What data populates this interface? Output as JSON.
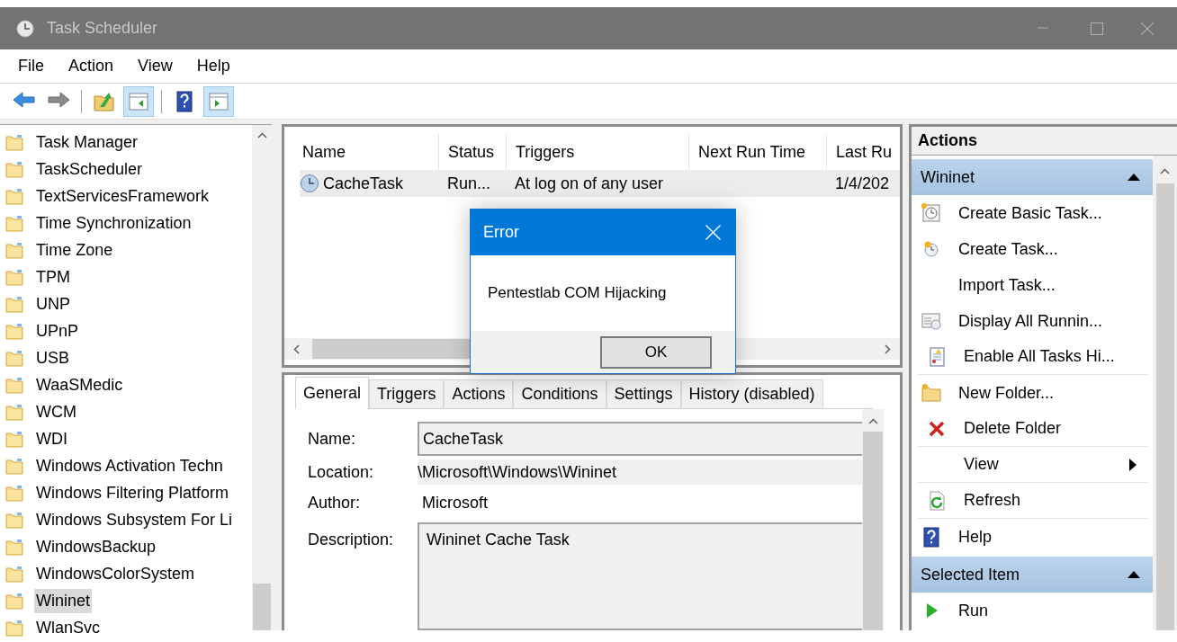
{
  "window": {
    "title": "Task Scheduler"
  },
  "menu": [
    "File",
    "Action",
    "View",
    "Help"
  ],
  "toolbar": [
    {
      "kind": "back",
      "selected": false
    },
    {
      "kind": "forward",
      "selected": false
    },
    {
      "kind": "up",
      "selected": false
    },
    {
      "kind": "console-tree",
      "selected": true
    },
    {
      "kind": "help",
      "selected": false
    },
    {
      "kind": "action-pane",
      "selected": true
    }
  ],
  "tree": {
    "items": [
      {
        "label": "Task Manager",
        "selected": false
      },
      {
        "label": "TaskScheduler",
        "selected": false
      },
      {
        "label": "TextServicesFramework",
        "selected": false
      },
      {
        "label": "Time Synchronization",
        "selected": false
      },
      {
        "label": "Time Zone",
        "selected": false
      },
      {
        "label": "TPM",
        "selected": false
      },
      {
        "label": "UNP",
        "selected": false
      },
      {
        "label": "UPnP",
        "selected": false
      },
      {
        "label": "USB",
        "selected": false
      },
      {
        "label": "WaaSMedic",
        "selected": false
      },
      {
        "label": "WCM",
        "selected": false
      },
      {
        "label": "WDI",
        "selected": false
      },
      {
        "label": "Windows Activation Techn",
        "selected": false
      },
      {
        "label": "Windows Filtering Platform",
        "selected": false
      },
      {
        "label": "Windows Subsystem For Li",
        "selected": false
      },
      {
        "label": "WindowsBackup",
        "selected": false
      },
      {
        "label": "WindowsColorSystem",
        "selected": false
      },
      {
        "label": "Wininet",
        "selected": true
      },
      {
        "label": "WlanSvc",
        "selected": false
      }
    ]
  },
  "task_list": {
    "columns": [
      "Name",
      "Status",
      "Triggers",
      "Next Run Time",
      "Last Ru"
    ],
    "rows": [
      {
        "cells": [
          "CacheTask",
          "Run...",
          "At log on of any user",
          "",
          "1/4/202"
        ],
        "selected": true
      }
    ]
  },
  "detail_tabs": [
    {
      "label": "General",
      "selected": true
    },
    {
      "label": "Triggers",
      "selected": false
    },
    {
      "label": "Actions",
      "selected": false
    },
    {
      "label": "Conditions",
      "selected": false
    },
    {
      "label": "Settings",
      "selected": false
    },
    {
      "label": "History (disabled)",
      "selected": false
    }
  ],
  "general": [
    {
      "label": "Name:",
      "value": "CacheTask",
      "kind": "box"
    },
    {
      "label": "Location:",
      "value": "\\Microsoft\\Windows\\Wininet",
      "kind": "shaded"
    },
    {
      "label": "Author:",
      "value": "Microsoft",
      "kind": "plain"
    },
    {
      "label": "Description:",
      "value": "Wininet Cache Task",
      "kind": "area"
    }
  ],
  "actions": {
    "title": "Actions",
    "sections": [
      {
        "title": "Wininet",
        "expanded": true,
        "items": [
          {
            "label": "Create Basic Task...",
            "kind": "basic-task",
            "divider_after": false
          },
          {
            "label": "Create Task...",
            "kind": "task",
            "divider_after": false
          },
          {
            "label": "Import Task...",
            "kind": "none",
            "divider_after": false
          },
          {
            "label": "Display All Runnin...",
            "kind": "running",
            "divider_after": false
          },
          {
            "label": "Enable All Tasks Hi...",
            "kind": "history",
            "divider_after": true
          },
          {
            "label": "New Folder...",
            "kind": "folder",
            "divider_after": false
          },
          {
            "label": "Delete Folder",
            "kind": "delete",
            "divider_after": true
          },
          {
            "label": "View",
            "kind": "submenu",
            "divider_after": true
          },
          {
            "label": "Refresh",
            "kind": "refresh",
            "divider_after": true
          },
          {
            "label": "Help",
            "kind": "help",
            "divider_after": false
          }
        ]
      },
      {
        "title": "Selected Item",
        "expanded": true,
        "items": [
          {
            "label": "Run",
            "kind": "run",
            "divider_after": false
          }
        ]
      }
    ]
  },
  "dialog": {
    "title": "Error",
    "message": "Pentestlab COM Hijacking",
    "button": "OK"
  }
}
